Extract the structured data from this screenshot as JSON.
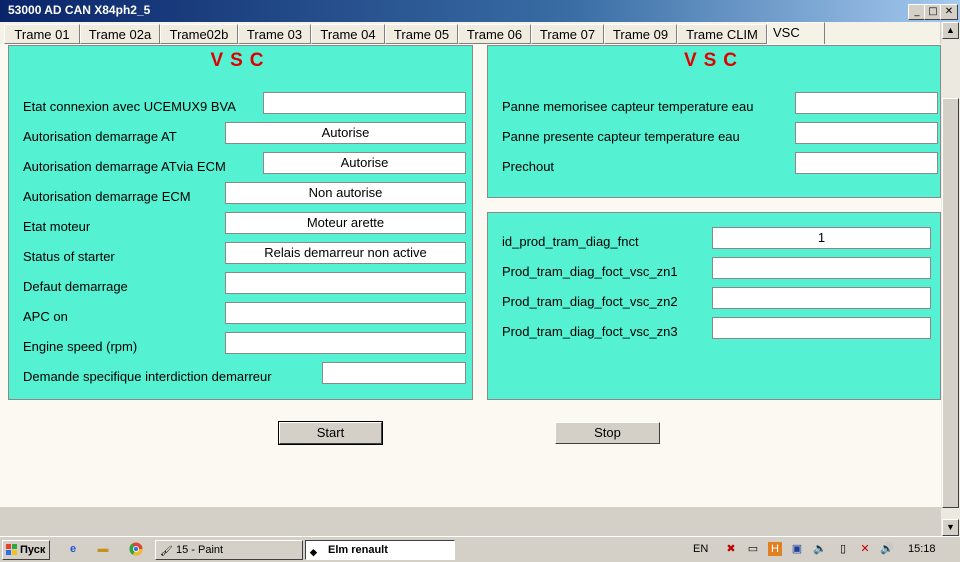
{
  "window": {
    "title": "53000 AD CAN X84ph2_5",
    "minimize": "_",
    "maximize": "□",
    "close": "✕"
  },
  "tabs": [
    {
      "label": "Trame 01"
    },
    {
      "label": "Trame 02a"
    },
    {
      "label": "Trame02b"
    },
    {
      "label": "Trame 03"
    },
    {
      "label": "Trame 04"
    },
    {
      "label": "Trame 05"
    },
    {
      "label": "Trame 06"
    },
    {
      "label": "Trame 07"
    },
    {
      "label": "Trame 09"
    },
    {
      "label": "Trame CLIM"
    },
    {
      "label": "VSC"
    }
  ],
  "active_tab": "VSC",
  "left_panel": {
    "title": "VSC",
    "rows": [
      {
        "label": "Etat connexion avec UCEMUX9 BVA",
        "value": ""
      },
      {
        "label": "Autorisation demarrage AT",
        "value": "Autorise"
      },
      {
        "label": "Autorisation demarrage ATvia ECM",
        "value": "Autorise"
      },
      {
        "label": "Autorisation demarrage ECM",
        "value": "Non autorise"
      },
      {
        "label": "Etat moteur",
        "value": "Moteur arette"
      },
      {
        "label": "Status of starter",
        "value": "Relais demarreur non active"
      },
      {
        "label": "Defaut demarrage",
        "value": ""
      },
      {
        "label": "APC on",
        "value": ""
      },
      {
        "label": "Engine speed (rpm)",
        "value": ""
      },
      {
        "label": "Demande specifique interdiction demarreur",
        "value": ""
      }
    ]
  },
  "right_top_panel": {
    "title": "VSC",
    "rows": [
      {
        "label": "Panne memorisee capteur temperature eau",
        "value": ""
      },
      {
        "label": "Panne presente capteur temperature eau",
        "value": ""
      },
      {
        "label": "Prechout",
        "value": ""
      }
    ]
  },
  "right_bottom_panel": {
    "rows": [
      {
        "label": "id_prod_tram_diag_fnct",
        "value": "1"
      },
      {
        "label": "Prod_tram_diag_foct_vsc_zn1",
        "value": ""
      },
      {
        "label": "Prod_tram_diag_foct_vsc_zn2",
        "value": ""
      },
      {
        "label": "Prod_tram_diag_foct_vsc_zn3",
        "value": ""
      }
    ]
  },
  "buttons": {
    "start": "Start",
    "stop": "Stop"
  },
  "taskbar": {
    "start_label": "Пуск",
    "tasks": [
      {
        "label": "15 - Paint"
      },
      {
        "label": "Elm renault"
      }
    ],
    "language": "EN",
    "clock": "15:18"
  },
  "icons": {
    "scroll_up": "scroll-up-arrow-icon",
    "scroll_down": "scroll-down-arrow-icon"
  },
  "colors": {
    "panel_bg": "#54f2d2",
    "vsc_title": "#e00000",
    "titlebar": "#0a246a"
  }
}
